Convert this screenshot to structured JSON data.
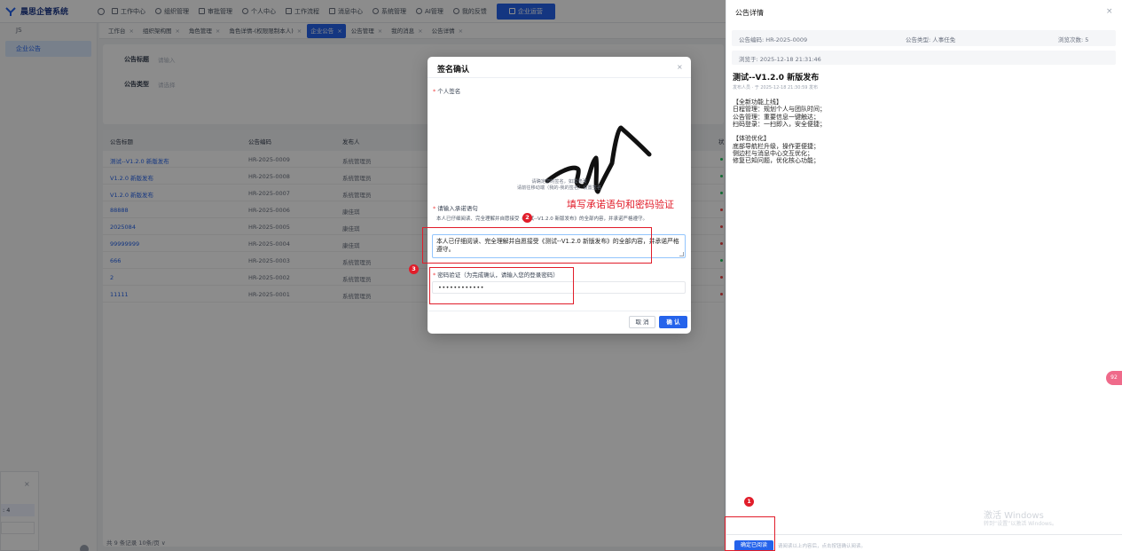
{
  "app": {
    "logo_text": "晨思企管系统",
    "nav": [
      {
        "label": "工作中心"
      },
      {
        "label": "组织管理"
      },
      {
        "label": "审批管理"
      },
      {
        "label": "个人中心"
      },
      {
        "label": "工作流程"
      },
      {
        "label": "消息中心"
      },
      {
        "label": "系统管理"
      },
      {
        "label": "AI管理"
      },
      {
        "label": "我的反馈"
      },
      {
        "label": "企业运营"
      }
    ],
    "sidebar_sub": "JS",
    "sidebar_item": "企业公告",
    "tabs": [
      {
        "label": "工作台"
      },
      {
        "label": "组织架构图"
      },
      {
        "label": "角色管理"
      },
      {
        "label": "角色详情-(权限限制本人)"
      },
      {
        "label": "企业公告"
      },
      {
        "label": "公告管理"
      },
      {
        "label": "我的消息"
      },
      {
        "label": "公告详情"
      }
    ],
    "tab_close": "×",
    "search": {
      "title_label": "公告标题",
      "title_placeholder": "请输入",
      "type_label": "公告类型",
      "type_placeholder": "请选择"
    },
    "table": {
      "headers": [
        "公告标题",
        "公告编码",
        "发布人",
        "状"
      ],
      "rows": [
        {
          "title": "测试--V1.2.0 新版发布",
          "code": "HR-2025-0009",
          "publisher": "系统管理员",
          "status_color": "#22c55e"
        },
        {
          "title": "V1.2.0 新版发布",
          "code": "HR-2025-0008",
          "publisher": "系统管理员",
          "status_color": "#22c55e"
        },
        {
          "title": "V1.2.0 新版发布",
          "code": "HR-2025-0007",
          "publisher": "系统管理员",
          "status_color": "#22c55e"
        },
        {
          "title": "88888",
          "code": "HR-2025-0006",
          "publisher": "康佳琪",
          "status_color": "#ef4444"
        },
        {
          "title": "2025084",
          "code": "HR-2025-0005",
          "publisher": "康佳琪",
          "status_color": "#ef4444"
        },
        {
          "title": "99999999",
          "code": "HR-2025-0004",
          "publisher": "康佳琪",
          "status_color": "#ef4444"
        },
        {
          "title": "666",
          "code": "HR-2025-0003",
          "publisher": "系统管理员",
          "status_color": "#22c55e"
        },
        {
          "title": "2",
          "code": "HR-2025-0002",
          "publisher": "系统管理员",
          "status_color": "#ef4444"
        },
        {
          "title": "11111",
          "code": "HR-2025-0001",
          "publisher": "系统管理员",
          "status_color": "#ef4444"
        }
      ],
      "pager": "共 9 条记录    10条/页  ∨"
    },
    "mini_dialog": {
      "close": "×",
      "field_value": ": 4"
    }
  },
  "drawer": {
    "title": "公告详情",
    "close": "×",
    "code": "公告编码: HR-2025-0009",
    "type": "公告类型: 人事任免",
    "views": "浏览次数: 5",
    "viewed_at": "浏览于: 2025-12-18 21:31:46",
    "doc_title": "测试--V1.2.0 新版发布",
    "doc_meta": "发布人员 · 于 2025-12-18 21:30:59 发布",
    "body": "【全新功能上线】\n日程管理：规划个人与团队时间；\n公告管理：重要信息一键触达；\n扫码登录：一扫即入，安全便捷；\n\n【体验优化】\n底部导航栏升级，操作更便捷；\n侧边栏与消息中心交互优化；\n修复已知问题，优化核心功能；",
    "confirm_read": "确定已阅读",
    "footer_hint": "请阅读以上内容后，点击按钮确认阅读。",
    "watermark_title": "激活 Windows",
    "watermark_sub": "转到“设置”以激活 Windows。",
    "float_badge": "92"
  },
  "modal": {
    "title": "签名确认",
    "close": "×",
    "signature_label": "个人签名",
    "sig_hint1": "请确定您的签名，如需修改",
    "sig_hint2": "请前往移动端（我的-我的签名）设置签名",
    "pledge_label": "请输入承诺语句",
    "pledge_reference": "本人已仔细阅读、完全理解并自愿接受《测试--V1.2.0 新版发布》的全部内容，并承诺严格遵守。",
    "pledge_value": "本人已仔细阅读、完全理解并自愿接受《测试--V1.2.0 新版发布》的全部内容，并承诺严格遵守。",
    "password_label": "密码验证（为完成确认，请输入您的登录密码）",
    "password_value": "••••••••••••",
    "cancel": "取 消",
    "ok": "确 认"
  },
  "annotations": {
    "step1": "1",
    "step2": "2",
    "step3": "3",
    "caption": "填写承诺语句和密码验证",
    "color": "#e11d2a"
  }
}
